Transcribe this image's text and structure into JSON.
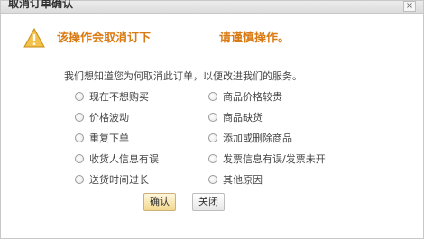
{
  "dialog": {
    "title": "取消订单确认",
    "close_symbol": "×"
  },
  "warning": {
    "part1": "该操作会取消订下",
    "part2": "请谨慎操作。",
    "icon": "warning-triangle-icon",
    "color": "#d97a12"
  },
  "intro": "我们想知道您为何取消此订单，以便改进我们的服务。",
  "reasons": {
    "left": [
      "现在不想购买",
      "价格波动",
      "重复下单",
      "收货人信息有误",
      "送货时间过长"
    ],
    "right": [
      "商品价格较贵",
      "商品缺货",
      "添加或删除商品",
      "发票信息有误/发票未开",
      "其他原因"
    ]
  },
  "buttons": {
    "confirm": "确认",
    "close": "关闭"
  }
}
